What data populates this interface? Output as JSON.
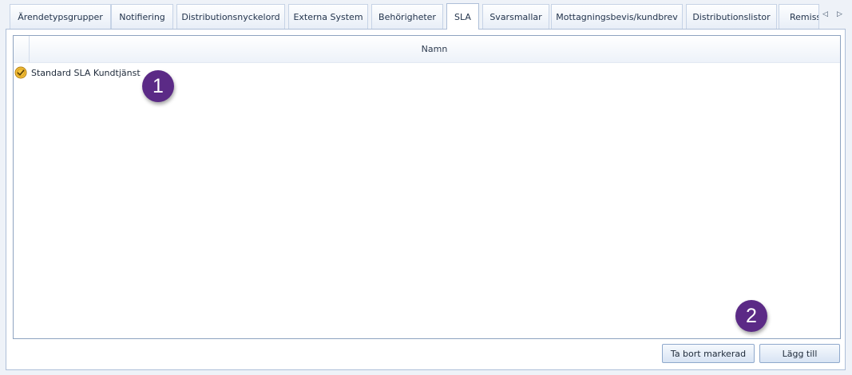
{
  "tabs": [
    {
      "label": "Ärendetypsgrupper"
    },
    {
      "label": "Notifiering"
    },
    {
      "label": "Distributionsnyckelord"
    },
    {
      "label": "Externa System"
    },
    {
      "label": "Behörigheter"
    },
    {
      "label": "SLA",
      "active": true
    },
    {
      "label": "Svarsmallar"
    },
    {
      "label": "Mottagningsbevis/kundbrev"
    },
    {
      "label": "Distributionslistor"
    },
    {
      "label": "Remiss"
    }
  ],
  "tab_nav": {
    "prev_icon": "triangle-left-icon",
    "next_icon": "triangle-right-icon"
  },
  "grid": {
    "column_header": "Namn",
    "rows": [
      {
        "name": "Standard SLA Kundtjänst",
        "icon": "sla-check-icon"
      }
    ]
  },
  "callouts": [
    {
      "label": "1"
    },
    {
      "label": "2"
    }
  ],
  "buttons": {
    "remove_label": "Ta bort markerad",
    "add_label": "Lägg till"
  },
  "colors": {
    "callout": "#5b2a86",
    "icon_gold": "#e3aa1c",
    "panel_border": "#aebfd8"
  }
}
